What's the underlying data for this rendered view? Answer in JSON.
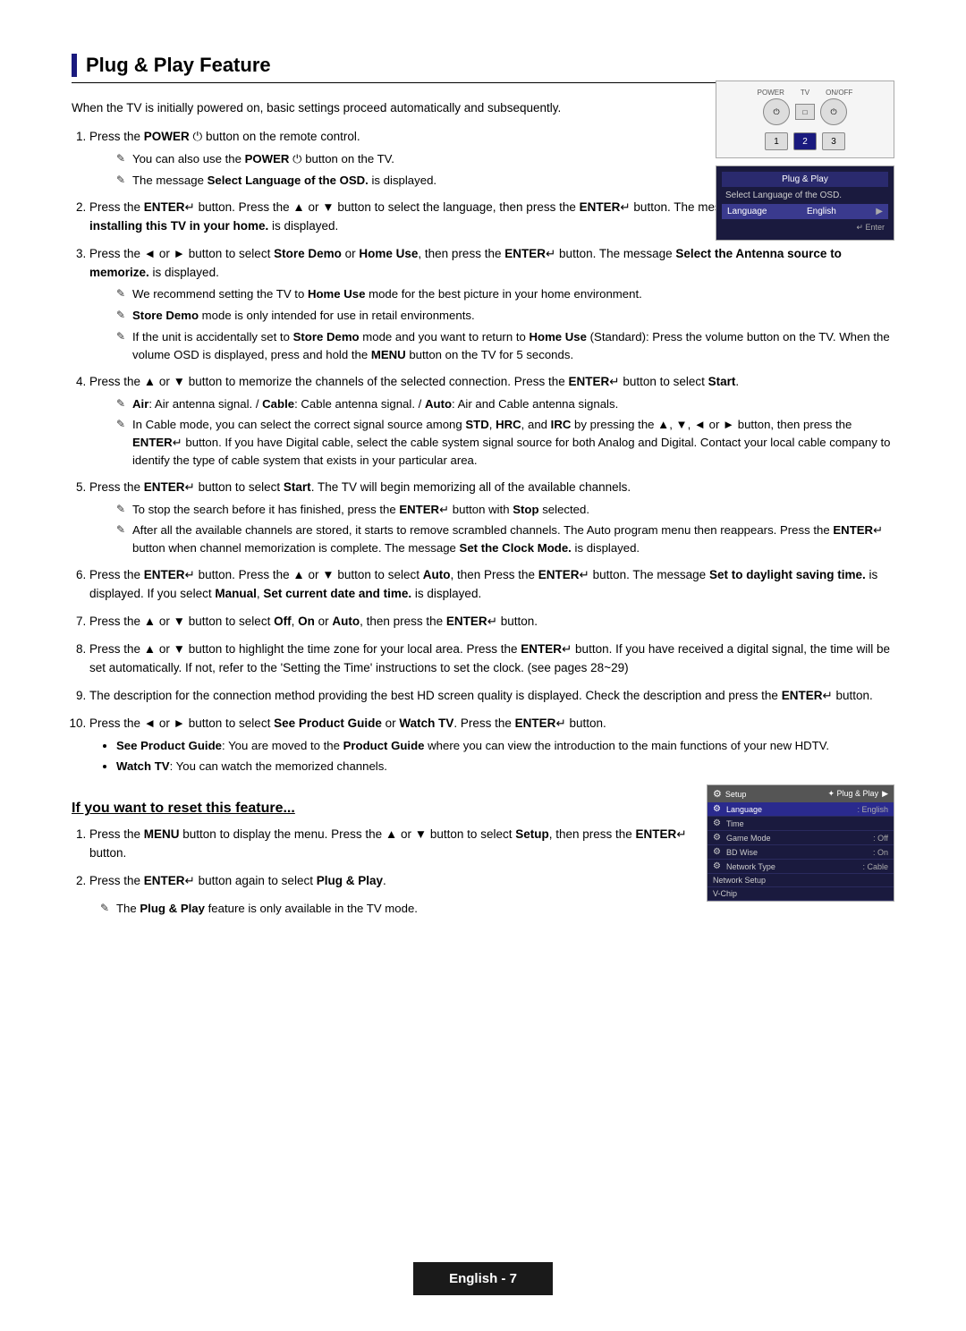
{
  "page": {
    "title": "Plug & Play Feature",
    "footer": "English - 7"
  },
  "intro": "When the TV is initially powered on, basic settings proceed automatically and subsequently.",
  "steps": [
    {
      "id": 1,
      "text": "Press the POWER button on the remote control.",
      "subs": [
        "You can also use the POWER button on the TV.",
        "The message Select Language of the OSD. is displayed."
      ]
    },
    {
      "id": 2,
      "text": "Press the ENTER button. Press the ▲ or ▼ button to select the language, then press the ENTER button. The message Select 'Home Use' when installing this TV in your home. is displayed."
    },
    {
      "id": 3,
      "text": "Press the ◄ or ► button to select Store Demo or Home Use, then press the ENTER button. The message Select the Antenna source to memorize. is displayed.",
      "subs": [
        "We recommend setting the TV to Home Use mode for the best picture in your home environment.",
        "Store Demo mode is only intended for use in retail environments.",
        "If the unit is accidentally set to Store Demo mode and you want to return to Home Use (Standard): Press the volume button on the TV. When the volume OSD is displayed, press and hold the MENU button on the TV for 5 seconds."
      ]
    },
    {
      "id": 4,
      "text": "Press the ▲ or ▼ button to memorize the channels of the selected connection. Press the ENTER button to select Start.",
      "subs": [
        "Air: Air antenna signal. / Cable: Cable antenna signal. / Auto: Air and Cable antenna signals.",
        "In Cable mode, you can select the correct signal source among STD, HRC, and IRC by pressing the ▲, ▼, ◄ or ► button, then press the ENTER button. If you have Digital cable, select the cable system signal source for both Analog and Digital. Contact your local cable company to identify the type of cable system that exists in your particular area."
      ]
    },
    {
      "id": 5,
      "text": "Press the ENTER button to select Start. The TV will begin memorizing all of the available channels.",
      "subs": [
        "To stop the search before it has finished, press the ENTER button with Stop selected.",
        "After all the available channels are stored, it starts to remove scrambled channels. The Auto program menu then reappears. Press the ENTER button when channel memorization is complete. The message Set the Clock Mode. is displayed."
      ]
    },
    {
      "id": 6,
      "text": "Press the ENTER button. Press the ▲ or ▼ button to select Auto, then Press the ENTER button. The message Set to daylight saving time. is displayed. If you select Manual, Set current date and time. is displayed."
    },
    {
      "id": 7,
      "text": "Press the ▲ or ▼ button to select Off, On or Auto, then press the ENTER button."
    },
    {
      "id": 8,
      "text": "Press the ▲ or ▼ button to highlight the time zone for your local area. Press the ENTER button. If you have received a digital signal, the time will be set automatically. If not, refer to the 'Setting the Time' instructions to set the clock. (see pages 28~29)"
    },
    {
      "id": 9,
      "text": "The description for the connection method providing the best HD screen quality is displayed. Check the description and press the ENTER button."
    },
    {
      "id": 10,
      "text": "Press the ◄ or ► button to select See Product Guide or Watch TV. Press the ENTER button.",
      "bullets": [
        "See Product Guide: You are moved to the Product Guide where you can view the introduction to the main functions of your new HDTV.",
        "Watch TV: You can watch the memorized channels."
      ]
    }
  ],
  "reset_section": {
    "title": "If you want to reset this feature...",
    "steps": [
      "Press the MENU button to display the menu. Press the ▲ or ▼ button to select Setup, then press the ENTER button.",
      "Press the ENTER button again to select Plug & Play.",
      "The Plug & Play feature is only available in the TV mode."
    ]
  },
  "remote_diagram": {
    "labels": [
      "POWER",
      "TV",
      "ON/OFF"
    ],
    "buttons": [
      "1",
      "2",
      "3"
    ],
    "active_button": "2"
  },
  "osd_diagram": {
    "title": "Plug & Play",
    "subtitle": "Select Language of the OSD.",
    "row_label": "Language",
    "row_value": "English"
  },
  "setup_diagram": {
    "title": "Plug & Play",
    "icon": "⚙",
    "rows": [
      {
        "label": "Language",
        "value": "English"
      },
      {
        "label": "Time",
        "value": ""
      },
      {
        "label": "Game Mode",
        "value": "Off"
      },
      {
        "label": "BD Wise",
        "value": "On"
      },
      {
        "label": "Network Type",
        "value": "Cable"
      },
      {
        "label": "Network Setup",
        "value": ""
      },
      {
        "label": "V-Chip",
        "value": ""
      }
    ]
  }
}
